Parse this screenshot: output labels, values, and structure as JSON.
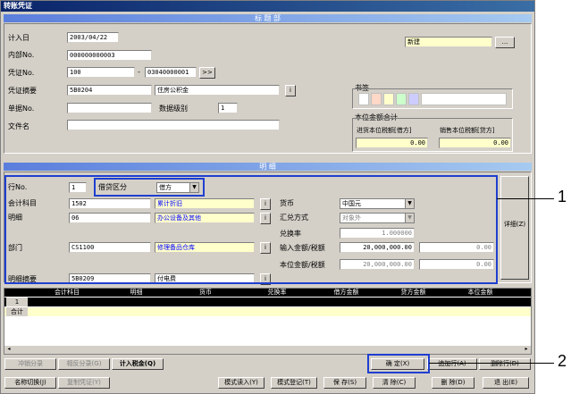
{
  "window": {
    "title": "转账凭证"
  },
  "header_section": {
    "title": "标 题 部"
  },
  "header": {
    "entry_date_label": "计入日",
    "entry_date": "2003/04/22",
    "internal_no_label": "内部No.",
    "internal_no": "000000000003",
    "voucher_no_label": "凭证No.",
    "voucher_no": "100",
    "voucher_no_sep": "-",
    "voucher_no_2": "03040000001",
    "voucher_nav": ">>",
    "summary_label": "凭证摘要",
    "summary_code": "5B0204",
    "summary_text": "住房公积金",
    "bill_no_label": "单据No.",
    "bill_no": "",
    "data_level_label": "数据级别",
    "data_level": "1",
    "file_name_label": "文件名",
    "file_name": "",
    "status": "新建",
    "status_button": "...",
    "info_button": "i"
  },
  "bookmark": {
    "label": "书签",
    "colors": [
      "#ffffff",
      "#ffd8c8",
      "#ffffcc",
      "#ccffcc",
      "#ccccff",
      "#ffffff"
    ]
  },
  "totals": {
    "label": "本位金额合计",
    "input_tax_label": "进货本位税额[借方]",
    "input_tax": "0.00",
    "sales_tax_label": "销售本位税额[贷方]",
    "sales_tax": "0.00"
  },
  "detail_section": {
    "title": "明 细"
  },
  "detail": {
    "row_no_label": "行No.",
    "row_no": "1",
    "dc_label": "借贷区分",
    "dc_value": "借方",
    "account_label": "会计科目",
    "account_code": "1502",
    "account_name": "累计折旧",
    "sub_label": "明细",
    "sub_code": "06",
    "sub_name": "办公设备及其他",
    "dept_label": "部门",
    "dept_code": "CS1100",
    "dept_name": "修理备品仓库",
    "detail_summary_label": "明细摘要",
    "detail_summary_code": "5B0209",
    "detail_summary_text": "付电费",
    "currency_label": "货币",
    "currency": "中国元",
    "exchange_label": "汇兑方式",
    "exchange": "对象外",
    "rate_label": "兑换率",
    "rate": "1.000000",
    "input_amount_label": "输入金额/税额",
    "input_amount": "20,000,000.00",
    "input_tax": "0.00",
    "base_amount_label": "本位金额/税额",
    "base_amount": "20,000,000.00",
    "base_tax": "0.00",
    "side_button": "详细(Z)",
    "info_button": "i"
  },
  "grid": {
    "columns": [
      "会计科目",
      "明细",
      "货币",
      "兑换率",
      "借方金额",
      "贷方金额",
      "本位金额"
    ],
    "row_label": "1",
    "total_label": "合计"
  },
  "buttons": {
    "offset_split": "冲销分录",
    "counter_split": "相反分录(G)",
    "calc_tax": "计入税金(Q)",
    "confirm": "确  定(X)",
    "add_row": "追加行(A)",
    "delete_row": "删除行(D)",
    "name_switch": "名称切换(J)",
    "copy_voucher": "复制凭证(Y)",
    "template_load": "模式读入(Y)",
    "template_save": "模式登记(T)",
    "save": "保  存(S)",
    "clear": "清  除(C)",
    "delete": "删  除(D)",
    "exit": "退  出(E)"
  },
  "callouts": {
    "one": "1",
    "two": "2"
  }
}
